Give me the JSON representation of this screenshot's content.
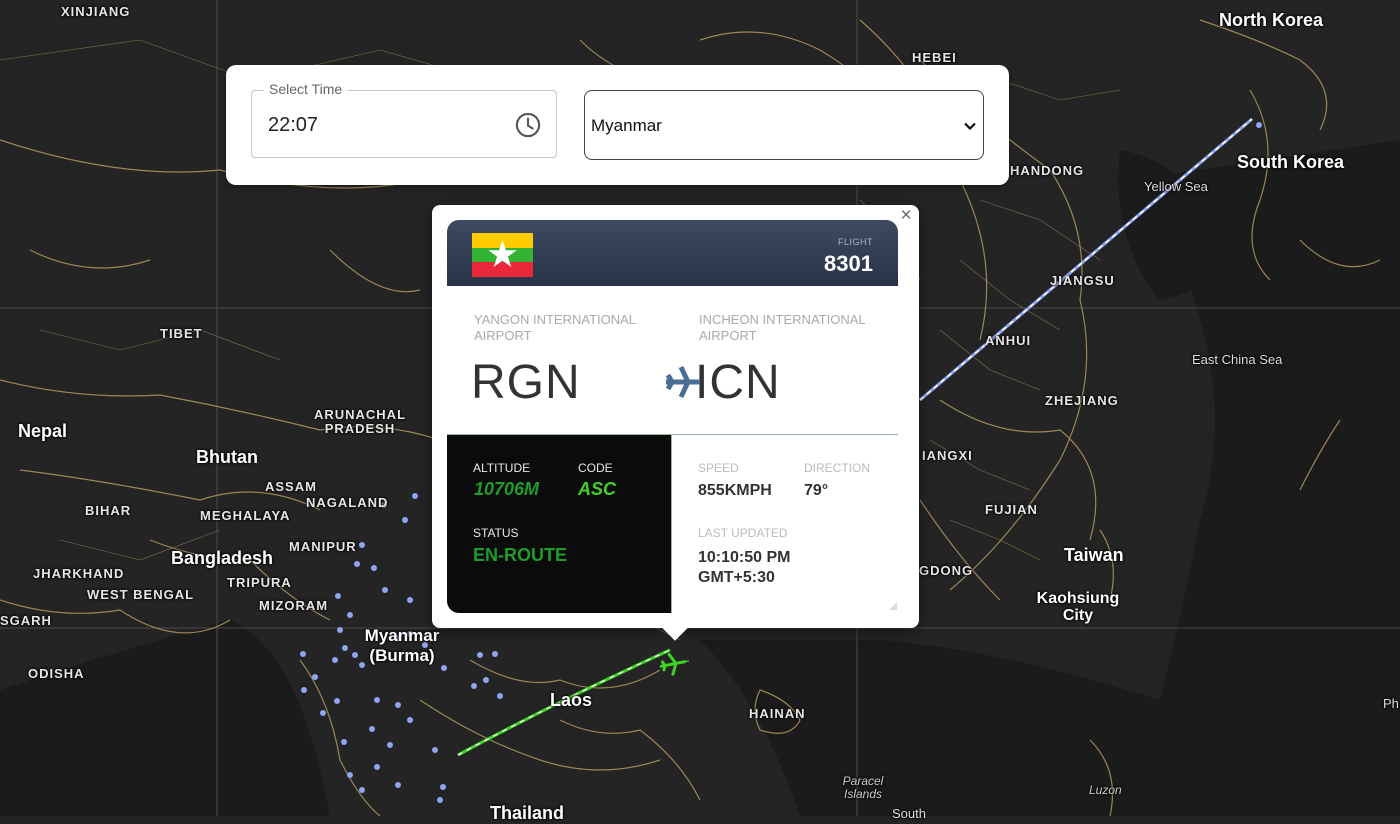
{
  "map": {
    "labels": {
      "xinjiang": "XINJIANG",
      "north_korea": "North Korea",
      "south_korea": "South Korea",
      "hebei": "HEBEI",
      "shandong": "HANDONG",
      "yellow_sea": "Yellow Sea",
      "jiangsu": "JIANGSU",
      "anhui": "ANHUI",
      "east_china_sea": "East China Sea",
      "zhejiang": "ZHEJIANG",
      "jiangxi": "IANGXI",
      "fujian": "FUJIAN",
      "taiwan": "Taiwan",
      "kaohsiung": "Kaohsiung City",
      "guangdong": "GDONG",
      "tibet": "TIBET",
      "nepal": "Nepal",
      "arunachal": "ARUNACHAL PRADESH",
      "bhutan": "Bhutan",
      "assam": "ASSAM",
      "nagaland": "NAGALAND",
      "bihar": "BIHAR",
      "meghalaya": "MEGHALAYA",
      "manipur": "MANIPUR",
      "bangladesh": "Bangladesh",
      "jharkhand": "JHARKHAND",
      "tripura": "TRIPURA",
      "west_bengal": "WEST BENGAL",
      "mizoram": "MIZORAM",
      "chhattisgarh": "SGARH",
      "myanmar": "Myanmar (Burma)",
      "odisha": "ODISHA",
      "laos": "Laos",
      "hainan": "HAINAN",
      "paracel": "Paracel Islands",
      "luzon": "Luzon",
      "thailand": "Thailand",
      "south": "South",
      "ph": "Ph"
    }
  },
  "controls": {
    "time_label": "Select Time",
    "time_value": "22:07",
    "country_value": "Myanmar"
  },
  "popup": {
    "close": "×",
    "flight_label": "FLIGHT",
    "flight_number": "8301",
    "origin_name": "YANGON INTERNATIONAL AIRPORT",
    "origin_code": "RGN",
    "dest_name": "INCHEON INTERNATIONAL AIRPORT",
    "dest_code": "ICN",
    "altitude_label": "ALTITUDE",
    "altitude_value": "10706M",
    "code_label": "CODE",
    "code_value": "ASC",
    "status_label": "STATUS",
    "status_value": "EN-ROUTE",
    "speed_label": "SPEED",
    "speed_value": "855KMPH",
    "direction_label": "DIRECTION",
    "direction_value": "79°",
    "updated_label": "LAST UPDATED",
    "updated_time": "10:10:50 PM",
    "updated_tz": "GMT+5:30"
  },
  "colors": {
    "green": "#3fd424",
    "status_green": "#1f9c2a",
    "route_blue": "#8fa5f0",
    "border_gold": "#a8915c",
    "header_navy": "#2f3a4f"
  }
}
